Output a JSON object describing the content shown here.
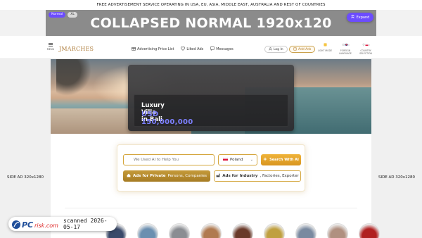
{
  "top_strip": {
    "text": "FREE ADVERTISEMENT SERVICE OPERATING IN USA, EU, ASIA, MIDDLE EAST, AUSTRALIA AND REST OF COUNTRIES"
  },
  "ad_banner": {
    "tag_normal": "Normal",
    "tag_xl": "XL",
    "title": "COLLAPSED NORMAL 1920x120",
    "expand_label": "Expand"
  },
  "header": {
    "menu_label": "MENU",
    "logo": "JMARCHES",
    "nav": [
      {
        "label": "Advertising Price List",
        "icon": "gift-icon"
      },
      {
        "label": "Liked Ads",
        "icon": "heart-icon"
      },
      {
        "label": "Messages",
        "icon": "chat-icon"
      }
    ],
    "login_label": "Log In",
    "add_ads_label": "Add Ads",
    "options": [
      {
        "label": "LIGHT MODE",
        "icon": "sun-icon"
      },
      {
        "label": "FOREIGN LANGUAGE",
        "icon": "flag-icon"
      },
      {
        "label": "COUNTRY SELECTION",
        "icon": "location-icon"
      }
    ]
  },
  "side_ads": {
    "left": "SIDE AD 320x1280",
    "right": "SIDE AD 320x1280"
  },
  "hero": {
    "title": "Luxury Villa in Bali",
    "price": "USD 150,000,000"
  },
  "search": {
    "placeholder": "We Used AI to Help You",
    "country": "Poland",
    "search_button": "Search With AI",
    "private_bold": "Ads for Private",
    "private_rest": "Persons, Companies",
    "industry_bold": "Ads for Industry",
    "industry_rest": ", Factories, Exporter"
  },
  "categories": [
    {
      "name": "category-1",
      "color": "#3a4a6a"
    },
    {
      "name": "category-2",
      "color": "#6b8fb0"
    },
    {
      "name": "category-3",
      "color": "#8a8d92"
    },
    {
      "name": "category-4",
      "color": "#b07a50"
    },
    {
      "name": "category-5",
      "color": "#6a3a2a"
    },
    {
      "name": "category-6",
      "color": "#c0a040"
    },
    {
      "name": "category-7",
      "color": "#7a8aa0"
    },
    {
      "name": "category-8",
      "color": "#b09080"
    },
    {
      "name": "category-9",
      "color": "#b02020"
    }
  ],
  "watermark": {
    "brand": "PCrisk.com",
    "scanned": "scanned 2026-05-17"
  },
  "colors": {
    "accent": "#6c4cff",
    "gold": "#d4a63d",
    "price": "#7d80ff"
  }
}
